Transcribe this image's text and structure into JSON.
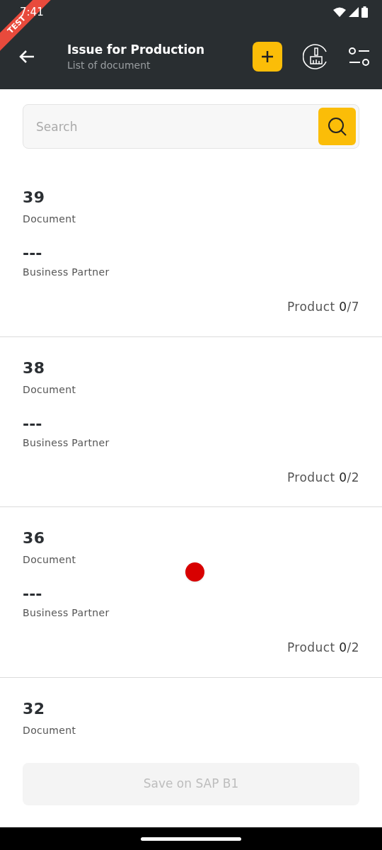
{
  "status_bar": {
    "time": "7:41"
  },
  "debug_banner": {
    "label": "TEST"
  },
  "header": {
    "title": "Issue for Production",
    "subtitle": "List of document"
  },
  "search": {
    "placeholder": "Search"
  },
  "documents": [
    {
      "number": "39",
      "number_label": "Document",
      "partner": "---",
      "partner_label": "Business Partner",
      "product_label": "Product",
      "picked": "0",
      "total": "/7"
    },
    {
      "number": "38",
      "number_label": "Document",
      "partner": "---",
      "partner_label": "Business Partner",
      "product_label": "Product",
      "picked": "0",
      "total": "/2"
    },
    {
      "number": "36",
      "number_label": "Document",
      "partner": "---",
      "partner_label": "Business Partner",
      "product_label": "Product",
      "picked": "0",
      "total": "/2"
    },
    {
      "number": "32",
      "number_label": "Document"
    }
  ],
  "save_button": {
    "label": "Save on SAP B1",
    "disabled": true
  }
}
